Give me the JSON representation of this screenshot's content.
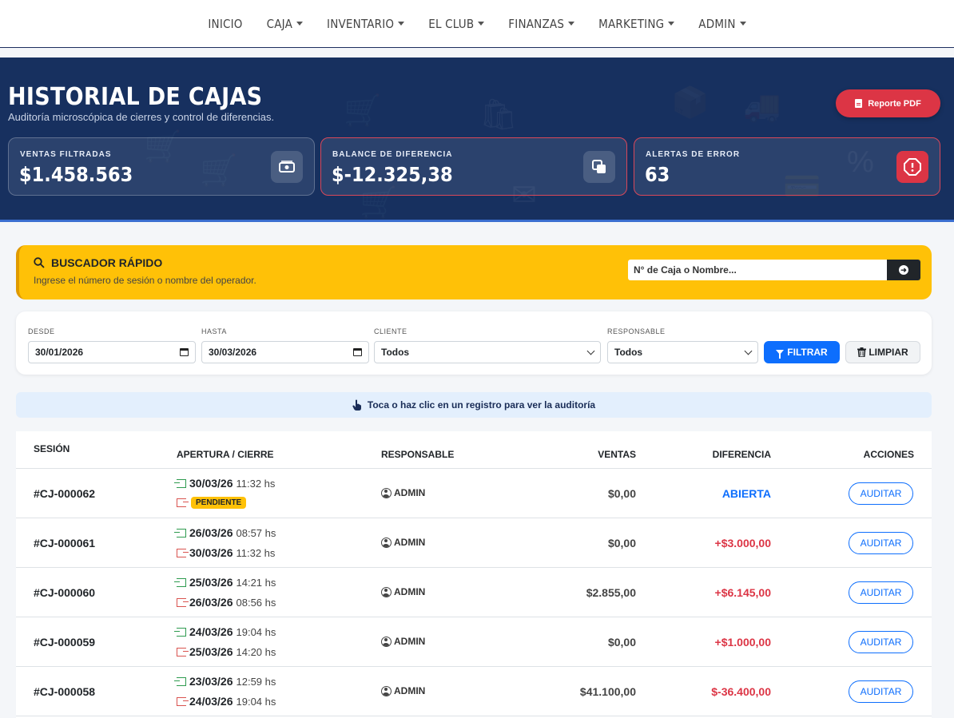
{
  "nav": {
    "items": [
      {
        "label": "INICIO",
        "dropdown": false
      },
      {
        "label": "CAJA",
        "dropdown": true
      },
      {
        "label": "INVENTARIO",
        "dropdown": true
      },
      {
        "label": "EL CLUB",
        "dropdown": true
      },
      {
        "label": "FINANZAS",
        "dropdown": true
      },
      {
        "label": "MARKETING",
        "dropdown": true
      },
      {
        "label": "ADMIN",
        "dropdown": true
      }
    ]
  },
  "header": {
    "title": "HISTORIAL DE CAJAS",
    "subtitle": "Auditoría microscópica de cierres y control de diferencias.",
    "pdf_button": "Reporte PDF"
  },
  "stats": [
    {
      "label": "VENTAS FILTRADAS",
      "value": "$1.458.563",
      "icon": "money-icon"
    },
    {
      "label": "BALANCE DE DIFERENCIA",
      "value": "$-12.325,38",
      "icon": "copy-icon"
    },
    {
      "label": "ALERTAS DE ERROR",
      "value": "63",
      "icon": "alert-icon"
    }
  ],
  "quick_search": {
    "title": "BUSCADOR RÁPIDO",
    "subtitle": "Ingrese el número de sesión o nombre del operador.",
    "placeholder": "N° de Caja o Nombre..."
  },
  "filters": {
    "desde_label": "DESDE",
    "desde_value": "30/01/2026",
    "hasta_label": "HASTA",
    "hasta_value": "30/03/2026",
    "cliente_label": "CLIENTE",
    "cliente_value": "Todos",
    "responsable_label": "RESPONSABLE",
    "responsable_value": "Todos",
    "filtrar_label": "FILTRAR",
    "limpiar_label": "LIMPIAR"
  },
  "hint": "Toca o haz clic en un registro para ver la auditoría",
  "table": {
    "headers": {
      "sesion": "SESIÓN",
      "apertura": "APERTURA / CIERRE",
      "responsable": "RESPONSABLE",
      "ventas": "VENTAS",
      "diferencia": "DIFERENCIA",
      "acciones": "ACCIONES"
    },
    "action_label": "AUDITAR",
    "rows": [
      {
        "session": "#CJ-000062",
        "open_date": "30/03/26",
        "open_time": "11:32 hs",
        "close_date": "",
        "close_time": "",
        "close_badge": "PENDIENTE",
        "responsible": "ADMIN",
        "sales": "$0,00",
        "difference": "ABIERTA",
        "diff_color": "#0d6efd"
      },
      {
        "session": "#CJ-000061",
        "open_date": "26/03/26",
        "open_time": "08:57 hs",
        "close_date": "30/03/26",
        "close_time": "11:32 hs",
        "close_badge": "",
        "responsible": "ADMIN",
        "sales": "$0,00",
        "difference": "+$3.000,00",
        "diff_color": "#dc3545"
      },
      {
        "session": "#CJ-000060",
        "open_date": "25/03/26",
        "open_time": "14:21 hs",
        "close_date": "26/03/26",
        "close_time": "08:56 hs",
        "close_badge": "",
        "responsible": "ADMIN",
        "sales": "$2.855,00",
        "difference": "+$6.145,00",
        "diff_color": "#dc3545"
      },
      {
        "session": "#CJ-000059",
        "open_date": "24/03/26",
        "open_time": "19:04 hs",
        "close_date": "25/03/26",
        "close_time": "14:20 hs",
        "close_badge": "",
        "responsible": "ADMIN",
        "sales": "$0,00",
        "difference": "+$1.000,00",
        "diff_color": "#dc3545"
      },
      {
        "session": "#CJ-000058",
        "open_date": "23/03/26",
        "open_time": "12:59 hs",
        "close_date": "24/03/26",
        "close_time": "19:04 hs",
        "close_badge": "",
        "responsible": "ADMIN",
        "sales": "$41.100,00",
        "difference": "$-36.400,00",
        "diff_color": "#dc3545"
      }
    ]
  },
  "colors": {
    "hero_bg": "#17305f",
    "accent_blue": "#0d6efd",
    "danger": "#dc3545",
    "warning": "#ffc107"
  }
}
